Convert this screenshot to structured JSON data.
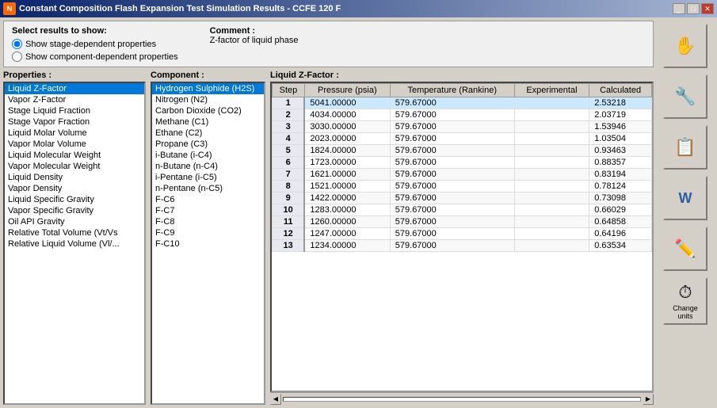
{
  "window": {
    "title": "Constant Composition Flash Expansion Test Simulation Results - CCFE 120 F",
    "icon": "N"
  },
  "options": {
    "title": "Select results to show:",
    "radio1": "Show stage-dependent properties",
    "radio2": "Show component-dependent properties",
    "comment_label": "Comment :",
    "comment_text": "Z-factor of liquid phase"
  },
  "properties": {
    "title": "Properties :",
    "items": [
      "Liquid Z-Factor",
      "Vapor Z-Factor",
      "Stage Liquid Fraction",
      "Stage Vapor Fraction",
      "Liquid Molar Volume",
      "Vapor Molar Volume",
      "Liquid Molecular Weight",
      "Vapor Molecular Weight",
      "Liquid Density",
      "Vapor Density",
      "Liquid Specific Gravity",
      "Vapor Specific Gravity",
      "Oil API Gravity",
      "Relative Total Volume (Vt/Vs",
      "Relative Liquid Volume (Vl/..."
    ],
    "selected_index": 0
  },
  "component": {
    "title": "Component :",
    "items": [
      "Hydrogen Sulphide (H2S)",
      "Nitrogen (N2)",
      "Carbon Dioxide (CO2)",
      "Methane (C1)",
      "Ethane (C2)",
      "Propane (C3)",
      "i-Butane (i-C4)",
      "n-Butane (n-C4)",
      "i-Pentane (i-C5)",
      "n-Pentane (n-C5)",
      "F-C6",
      "F-C7",
      "F-C8",
      "F-C9",
      "F-C10"
    ],
    "selected_index": 0
  },
  "table": {
    "title": "Liquid Z-Factor :",
    "columns": [
      "Step",
      "Pressure (psia)",
      "Temperature (Rankine)",
      "Experimental",
      "Calculated"
    ],
    "rows": [
      {
        "step": "1",
        "pressure": "5041.00000",
        "temperature": "579.67000",
        "experimental": "",
        "calculated": "2.53218"
      },
      {
        "step": "2",
        "pressure": "4034.00000",
        "temperature": "579.67000",
        "experimental": "",
        "calculated": "2.03719"
      },
      {
        "step": "3",
        "pressure": "3030.00000",
        "temperature": "579.67000",
        "experimental": "",
        "calculated": "1.53946"
      },
      {
        "step": "4",
        "pressure": "2023.00000",
        "temperature": "579.67000",
        "experimental": "",
        "calculated": "1.03504"
      },
      {
        "step": "5",
        "pressure": "1824.00000",
        "temperature": "579.67000",
        "experimental": "",
        "calculated": "0.93463"
      },
      {
        "step": "6",
        "pressure": "1723.00000",
        "temperature": "579.67000",
        "experimental": "",
        "calculated": "0.88357"
      },
      {
        "step": "7",
        "pressure": "1621.00000",
        "temperature": "579.67000",
        "experimental": "",
        "calculated": "0.83194"
      },
      {
        "step": "8",
        "pressure": "1521.00000",
        "temperature": "579.67000",
        "experimental": "",
        "calculated": "0.78124"
      },
      {
        "step": "9",
        "pressure": "1422.00000",
        "temperature": "579.67000",
        "experimental": "",
        "calculated": "0.73098"
      },
      {
        "step": "10",
        "pressure": "1283.00000",
        "temperature": "579.67000",
        "experimental": "",
        "calculated": "0.66029"
      },
      {
        "step": "11",
        "pressure": "1260.00000",
        "temperature": "579.67000",
        "experimental": "",
        "calculated": "0.64858"
      },
      {
        "step": "12",
        "pressure": "1247.00000",
        "temperature": "579.67000",
        "experimental": "",
        "calculated": "0.64196"
      },
      {
        "step": "13",
        "pressure": "1234.00000",
        "temperature": "579.67000",
        "experimental": "",
        "calculated": "0.63534"
      }
    ]
  },
  "sidebar": {
    "buttons": [
      {
        "label": "✋",
        "name": "hand-tool",
        "text": ""
      },
      {
        "label": "🔧",
        "name": "tools",
        "text": ""
      },
      {
        "label": "📋",
        "name": "clipboard",
        "text": ""
      },
      {
        "label": "📝",
        "name": "word",
        "text": ""
      },
      {
        "label": "✏️",
        "name": "pencil",
        "text": ""
      },
      {
        "label": "⏱",
        "name": "clock",
        "text": "Change units"
      }
    ]
  }
}
